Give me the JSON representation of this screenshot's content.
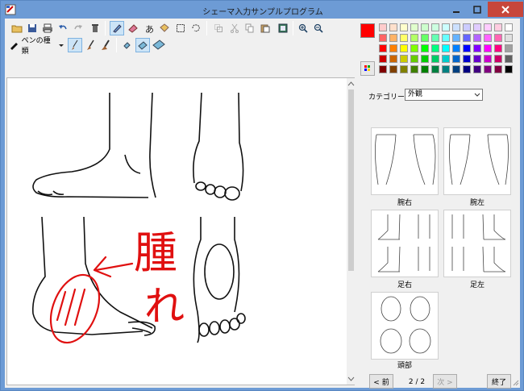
{
  "window": {
    "title": "シェーマ入力サンプルプログラム"
  },
  "toolbar": {
    "row1_icons": [
      "open-folder-icon",
      "save-icon",
      "print-icon",
      "undo-icon",
      "redo-icon",
      "trash-icon",
      "pen-icon",
      "eraser-icon",
      "text-icon",
      "bucket-icon",
      "rect-select-icon",
      "lasso-select-icon",
      "copy-region-icon",
      "cut-icon",
      "copy-icon",
      "paste-icon",
      "image-icon",
      "zoom-in-icon",
      "zoom-out-icon"
    ],
    "pen_kind_label": "ペンの種類",
    "row2_icons": [
      "brush-thin-icon",
      "brush-mid-icon",
      "brush-thick-icon",
      "eraser-small-icon",
      "eraser-mid-icon",
      "eraser-large-icon"
    ]
  },
  "colors": {
    "current": "#ff0000",
    "palette": [
      [
        "#ffcccc",
        "#ffe0cc",
        "#ffffcc",
        "#e0ffcc",
        "#ccffcc",
        "#ccffe0",
        "#ccffff",
        "#cce0ff",
        "#ccccff",
        "#e0ccff",
        "#ffccff",
        "#ffcce0",
        "#ffffff"
      ],
      [
        "#ff6666",
        "#ffb366",
        "#ffff66",
        "#b3ff66",
        "#66ff66",
        "#66ffb3",
        "#66ffff",
        "#66b3ff",
        "#6666ff",
        "#b366ff",
        "#ff66ff",
        "#ff66b3",
        "#e0e0e0"
      ],
      [
        "#ff0000",
        "#ff8000",
        "#ffff00",
        "#80ff00",
        "#00ff00",
        "#00ff80",
        "#00ffff",
        "#0080ff",
        "#0000ff",
        "#8000ff",
        "#ff00ff",
        "#ff0080",
        "#a0a0a0"
      ],
      [
        "#cc0000",
        "#cc6600",
        "#cccc00",
        "#66cc00",
        "#00cc00",
        "#00cc66",
        "#00cccc",
        "#0066cc",
        "#0000cc",
        "#6600cc",
        "#cc00cc",
        "#cc0066",
        "#606060"
      ],
      [
        "#800000",
        "#804000",
        "#808000",
        "#408000",
        "#008000",
        "#008040",
        "#008080",
        "#004080",
        "#000080",
        "#400080",
        "#800080",
        "#800040",
        "#000000"
      ]
    ]
  },
  "canvas": {
    "annotation_text_1": "腫",
    "annotation_text_2": "れ"
  },
  "side": {
    "category_label": "カテゴリー:",
    "category_value": "外観",
    "thumbnails": [
      {
        "label": "腕右"
      },
      {
        "label": "腕左"
      },
      {
        "label": "足右"
      },
      {
        "label": "足左"
      },
      {
        "label": "頭部"
      }
    ],
    "prev_button": "< 前",
    "page_indicator": "2 / 2",
    "next_button": "次 >",
    "close_button": "終了"
  }
}
